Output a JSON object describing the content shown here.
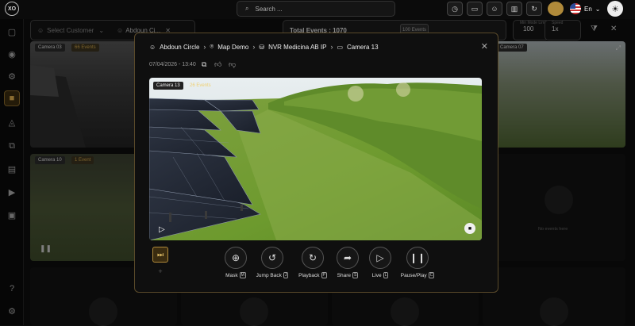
{
  "app": {
    "logo_text": "XO"
  },
  "search": {
    "placeholder": "Search ..."
  },
  "header": {
    "language": "En"
  },
  "filters": {
    "customer_placeholder": "Select Customer",
    "site_value": "Abdoun Ci...",
    "total_events": "Total Events : 1070",
    "events_button": "100 Events",
    "min_mode_label": "Min Mode Limit",
    "min_mode_value": "100",
    "speed_label": "Speed",
    "speed_value": "1x"
  },
  "tiles": [
    {
      "camera": "Camera 03",
      "badge": "66 Events"
    },
    {
      "camera": "Camera 10",
      "badge": "1 Event"
    },
    {
      "camera": "Camera 07",
      "badge": ""
    },
    {
      "empty_text": "No events here"
    }
  ],
  "modal": {
    "breadcrumb": [
      "Abdoun Circle",
      "Map Demo",
      "NVR Medicina AB IP",
      "Camera 13"
    ],
    "date": "07/04/2026 - 13:40",
    "video": {
      "camera": "Camera 13",
      "badge": "26 Events"
    },
    "controls": [
      {
        "label": "Mask",
        "key": "M"
      },
      {
        "label": "Jump Back",
        "key": "J"
      },
      {
        "label": "Playback",
        "key": "P"
      },
      {
        "label": "Share",
        "key": "S"
      },
      {
        "label": "Live",
        "key": "L"
      },
      {
        "label": "Pause/Play",
        "key": "C"
      }
    ]
  },
  "colors": {
    "accent": "#d4a93c",
    "modal_border": "#5a4a2a",
    "background": "#0d0d0d"
  }
}
